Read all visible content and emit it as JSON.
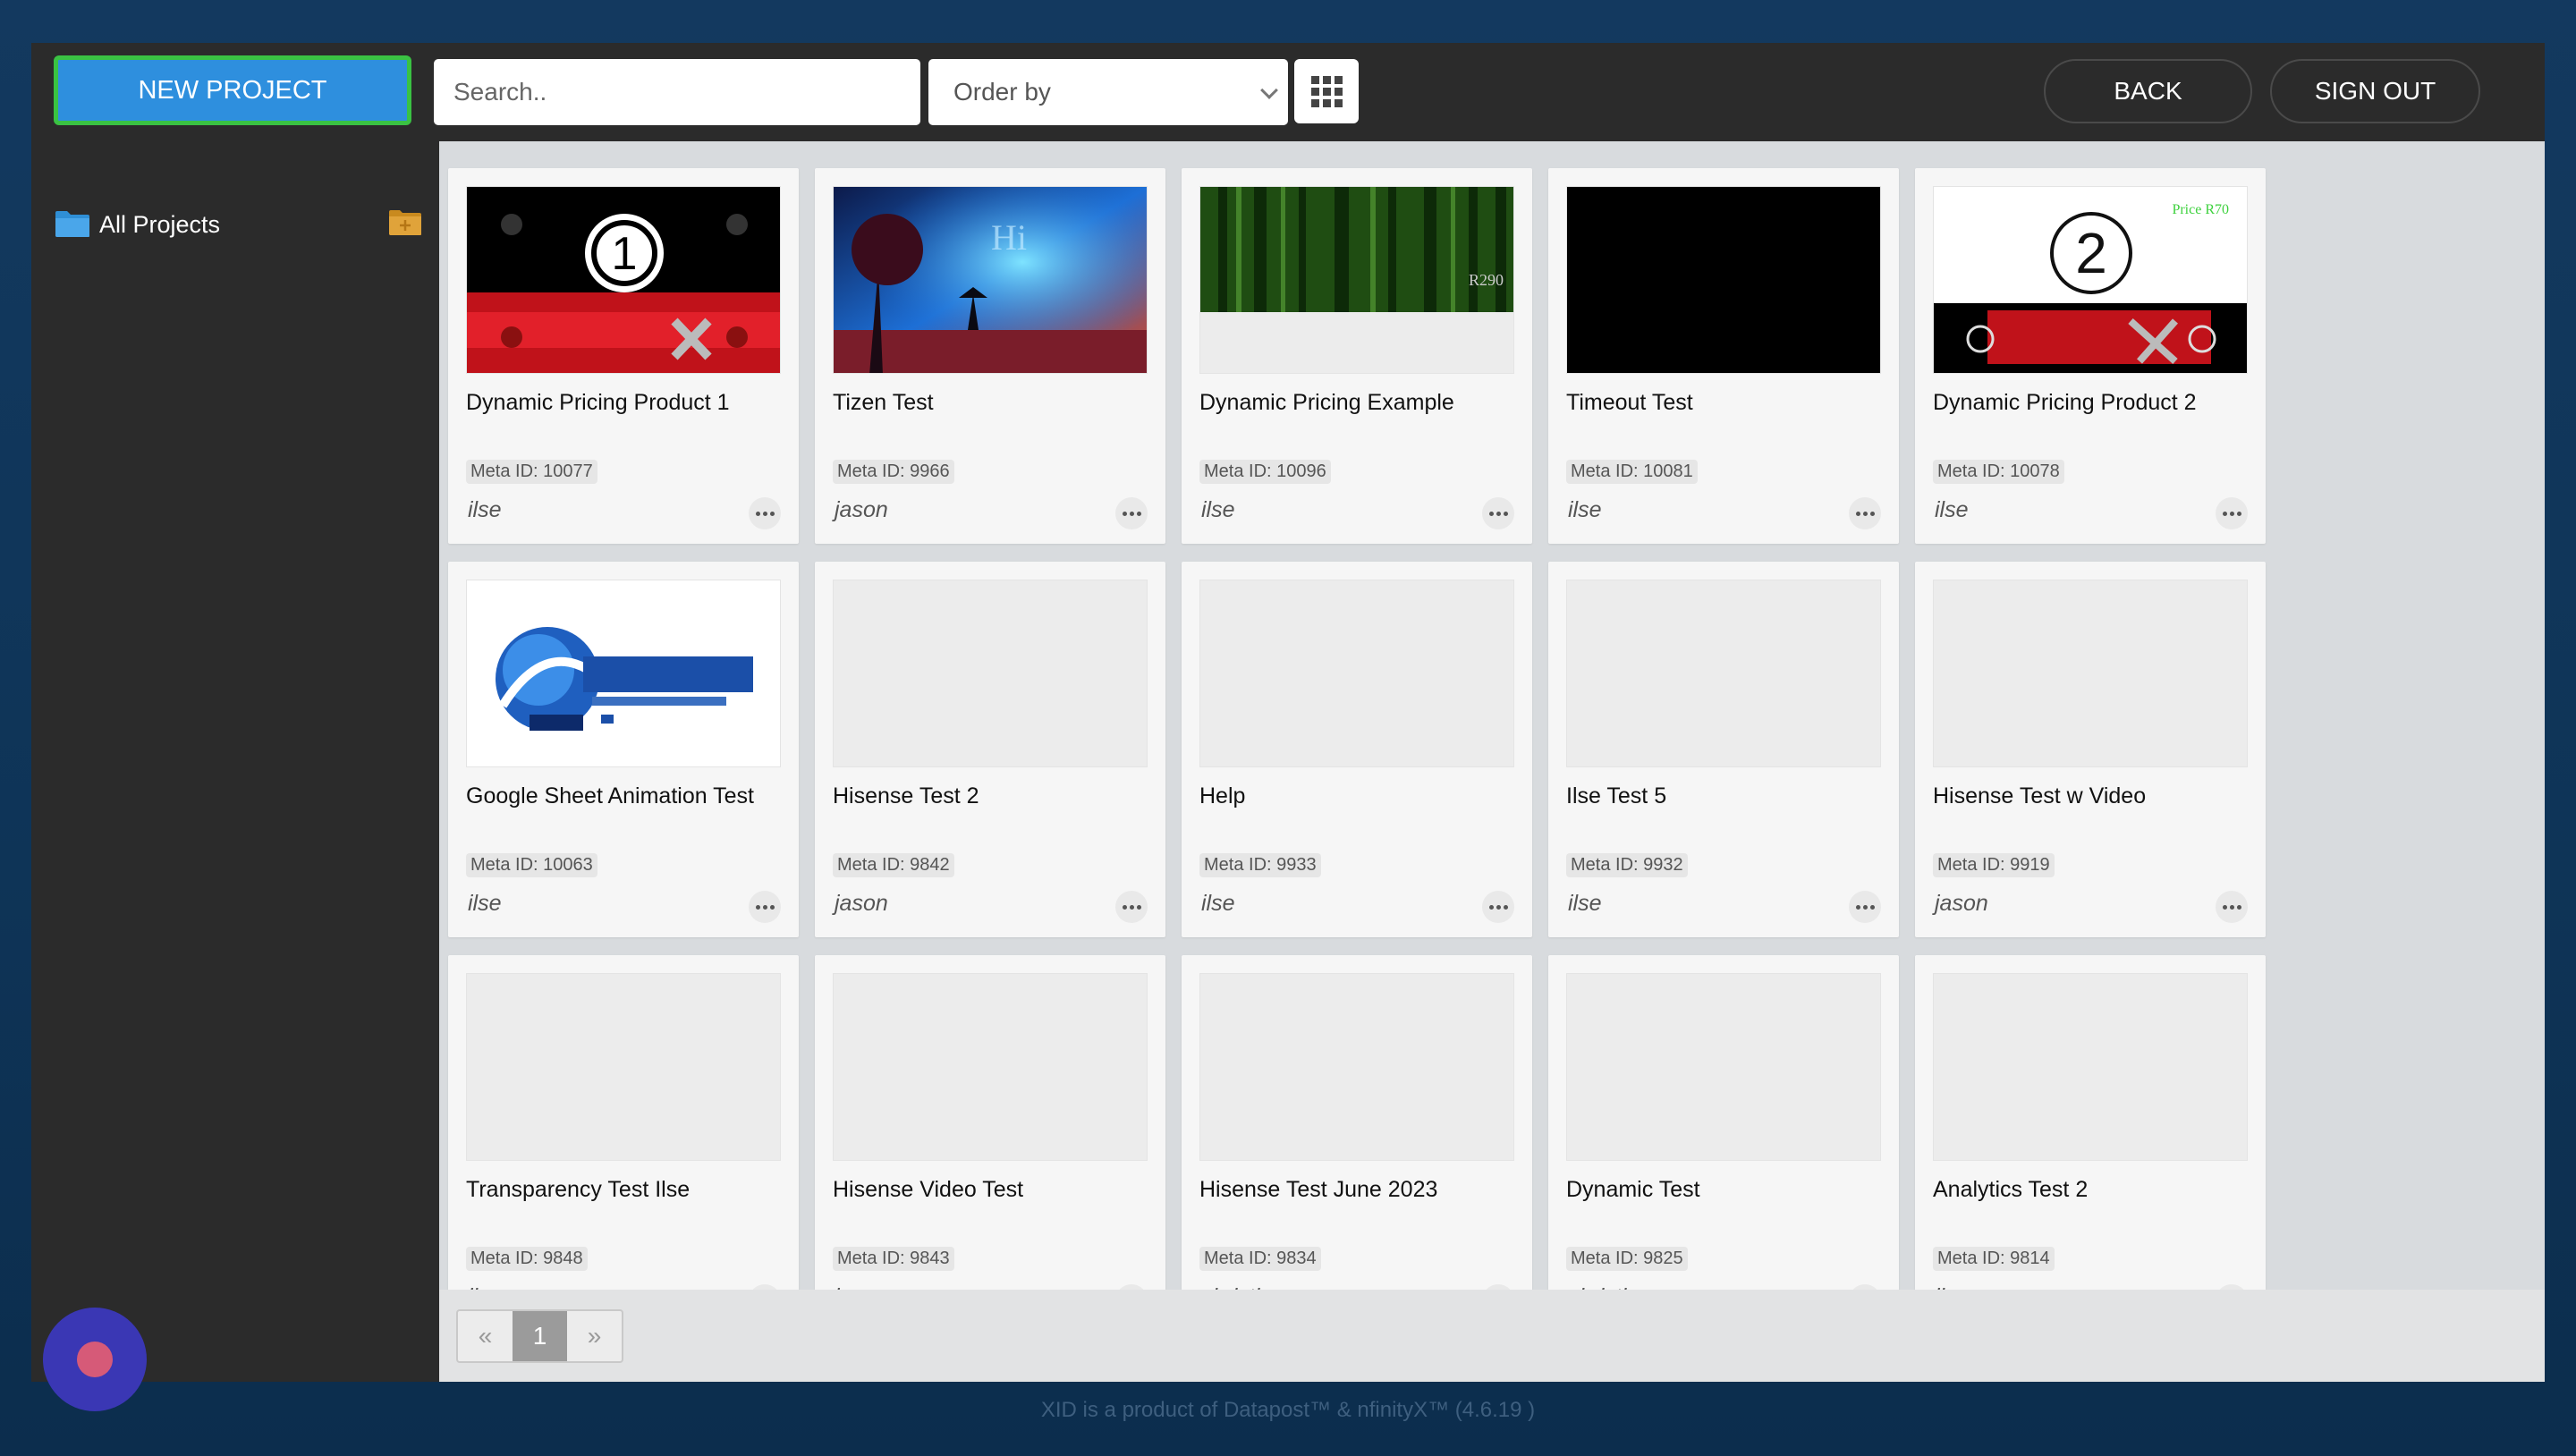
{
  "toolbar": {
    "new_project_label": "NEW PROJECT",
    "search_placeholder": "Search..",
    "order_by_label": "Order by",
    "back_label": "BACK",
    "signout_label": "SIGN OUT"
  },
  "sidebar": {
    "items": [
      {
        "label": "All Projects"
      }
    ]
  },
  "projects": [
    {
      "title": "Dynamic Pricing Product 1",
      "meta": "Meta ID: 10077",
      "owner": "ilse",
      "thumb": "pricing1"
    },
    {
      "title": "Tizen Test",
      "meta": "Meta ID: 9966",
      "owner": "jason",
      "thumb": "tizen",
      "overlay": "Hi"
    },
    {
      "title": "Dynamic Pricing Example",
      "meta": "Meta ID: 10096",
      "owner": "ilse",
      "thumb": "forest",
      "overlay": "R290"
    },
    {
      "title": "Timeout Test",
      "meta": "Meta ID: 10081",
      "owner": "ilse",
      "thumb": "black"
    },
    {
      "title": "Dynamic Pricing Product 2",
      "meta": "Meta ID: 10078",
      "owner": "ilse",
      "thumb": "pricing2",
      "overlay": "Price R70"
    },
    {
      "title": "Google Sheet Animation Test",
      "meta": "Meta ID: 10063",
      "owner": "ilse",
      "thumb": "datapost"
    },
    {
      "title": "Hisense Test 2",
      "meta": "Meta ID: 9842",
      "owner": "jason",
      "thumb": "empty"
    },
    {
      "title": "Help",
      "meta": "Meta ID: 9933",
      "owner": "ilse",
      "thumb": "empty"
    },
    {
      "title": "Ilse Test 5",
      "meta": "Meta ID: 9932",
      "owner": "ilse",
      "thumb": "empty"
    },
    {
      "title": "Hisense Test w Video",
      "meta": "Meta ID: 9919",
      "owner": "jason",
      "thumb": "empty"
    },
    {
      "title": "Transparency Test Ilse",
      "meta": "Meta ID: 9848",
      "owner": "ilse",
      "thumb": "empty"
    },
    {
      "title": "Hisense Video Test",
      "meta": "Meta ID: 9843",
      "owner": "jason",
      "thumb": "empty"
    },
    {
      "title": "Hisense Test June 2023",
      "meta": "Meta ID: 9834",
      "owner": "christiaan",
      "thumb": "empty"
    },
    {
      "title": "Dynamic Test",
      "meta": "Meta ID: 9825",
      "owner": "christiaan",
      "thumb": "empty"
    },
    {
      "title": "Analytics Test 2",
      "meta": "Meta ID: 9814",
      "owner": "ilse",
      "thumb": "empty"
    }
  ],
  "pagination": {
    "prev": "«",
    "current": "1",
    "next": "»"
  },
  "footer": {
    "text": "XID is a product of Datapost™ & nfinityX™ (4.6.19 )"
  },
  "icons": {
    "folder": "folder-icon",
    "add_folder": "add-folder-icon",
    "grid": "grid-view-icon",
    "more": "more-options-icon",
    "chat": "chat-widget-icon"
  },
  "colors": {
    "primary_button": "#2e8fde",
    "primary_button_border": "#3ac243",
    "app_background": "#2b2b2b",
    "content_background": "#d8dbde",
    "page_background": "#13395f",
    "chat_widget": "#3a37b4"
  }
}
